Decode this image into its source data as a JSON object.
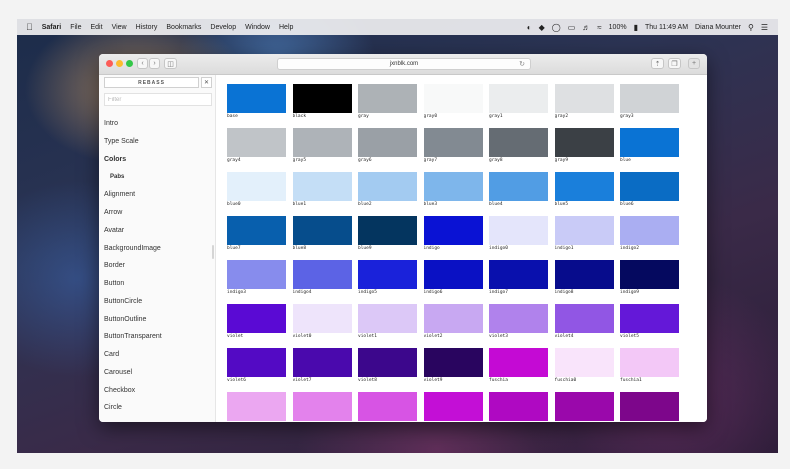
{
  "menubar": {
    "apple_icon": "apple-icon",
    "app": "Safari",
    "items": [
      "File",
      "Edit",
      "View",
      "History",
      "Bookmarks",
      "Develop",
      "Window",
      "Help"
    ],
    "battery": "100%",
    "clock": "Thu 11:49 AM",
    "user": "Diana Mounter"
  },
  "browser": {
    "url": "jxnblk.com"
  },
  "sidebar": {
    "rebass_label": "REBASS",
    "close_label": "✕",
    "filter_placeholder": "Filter",
    "items": [
      {
        "label": "Intro"
      },
      {
        "label": "Type Scale"
      },
      {
        "label": "Colors"
      },
      {
        "label": "Pabs"
      },
      {
        "label": "Alignment"
      },
      {
        "label": "Arrow"
      },
      {
        "label": "Avatar"
      },
      {
        "label": "BackgroundImage"
      },
      {
        "label": "Border"
      },
      {
        "label": "Button"
      },
      {
        "label": "ButtonCircle"
      },
      {
        "label": "ButtonOutline"
      },
      {
        "label": "ButtonTransparent"
      },
      {
        "label": "Card"
      },
      {
        "label": "Carousel"
      },
      {
        "label": "Checkbox"
      },
      {
        "label": "Circle"
      }
    ]
  },
  "swatches": [
    {
      "name": "base",
      "color": "#0a73d4"
    },
    {
      "name": "black",
      "color": "#000000"
    },
    {
      "name": "gray",
      "color": "#adb2b6"
    },
    {
      "name": "gray0",
      "color": "#f8f9f9"
    },
    {
      "name": "gray1",
      "color": "#ebedee"
    },
    {
      "name": "gray2",
      "color": "#dee0e2"
    },
    {
      "name": "gray3",
      "color": "#d0d3d6"
    },
    {
      "name": "gray4",
      "color": "#c0c4c8"
    },
    {
      "name": "gray5",
      "color": "#aeb3b8"
    },
    {
      "name": "gray6",
      "color": "#9aa0a6"
    },
    {
      "name": "gray7",
      "color": "#828a92"
    },
    {
      "name": "gray8",
      "color": "#656c73"
    },
    {
      "name": "gray9",
      "color": "#3b4045"
    },
    {
      "name": "blue",
      "color": "#0a73d4"
    },
    {
      "name": "blue0",
      "color": "#e3f0fb"
    },
    {
      "name": "blue1",
      "color": "#c4def6"
    },
    {
      "name": "blue2",
      "color": "#a3cbf1"
    },
    {
      "name": "blue3",
      "color": "#7eb6eb"
    },
    {
      "name": "blue4",
      "color": "#519de4"
    },
    {
      "name": "blue5",
      "color": "#1a7fdb"
    },
    {
      "name": "blue6",
      "color": "#0a6cc4"
    },
    {
      "name": "blue7",
      "color": "#085fad"
    },
    {
      "name": "blue8",
      "color": "#064d8c"
    },
    {
      "name": "blue9",
      "color": "#04355f"
    },
    {
      "name": "indigo",
      "color": "#0a12d4"
    },
    {
      "name": "indigo0",
      "color": "#e4e5fb"
    },
    {
      "name": "indigo1",
      "color": "#c9cbf7"
    },
    {
      "name": "indigo2",
      "color": "#aaaef2"
    },
    {
      "name": "indigo3",
      "color": "#878ced"
    },
    {
      "name": "indigo4",
      "color": "#5c63e5"
    },
    {
      "name": "indigo5",
      "color": "#1a22da"
    },
    {
      "name": "indigo6",
      "color": "#0a11c4"
    },
    {
      "name": "indigo7",
      "color": "#0910ad"
    },
    {
      "name": "indigo8",
      "color": "#070c8c"
    },
    {
      "name": "indigo9",
      "color": "#05095f"
    },
    {
      "name": "violet",
      "color": "#5a0ad4"
    },
    {
      "name": "violet0",
      "color": "#eee4fb"
    },
    {
      "name": "violet1",
      "color": "#dcc8f7"
    },
    {
      "name": "violet2",
      "color": "#c8a8f2"
    },
    {
      "name": "violet3",
      "color": "#b082ec"
    },
    {
      "name": "violet4",
      "color": "#9156e4"
    },
    {
      "name": "violet5",
      "color": "#6418d8"
    },
    {
      "name": "violet6",
      "color": "#530ac4"
    },
    {
      "name": "violet7",
      "color": "#4a09ad"
    },
    {
      "name": "violet8",
      "color": "#3c078c"
    },
    {
      "name": "violet9",
      "color": "#29055f"
    },
    {
      "name": "fuschia",
      "color": "#c40ad4"
    },
    {
      "name": "fuschia0",
      "color": "#f9e4fb"
    },
    {
      "name": "fuschia1",
      "color": "#f3c8f7"
    },
    {
      "name": "",
      "color": "#eba7f1"
    },
    {
      "name": "",
      "color": "#e382ec"
    },
    {
      "name": "",
      "color": "#d754e4"
    },
    {
      "name": "",
      "color": "#c30fd6"
    },
    {
      "name": "",
      "color": "#af09c2"
    },
    {
      "name": "",
      "color": "#9a08ab"
    },
    {
      "name": "",
      "color": "#7d068b"
    }
  ]
}
